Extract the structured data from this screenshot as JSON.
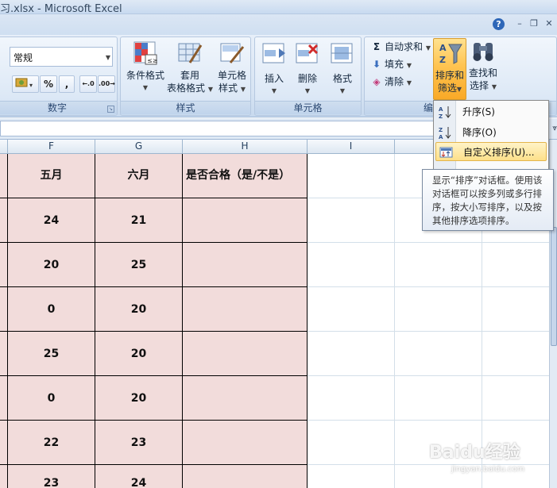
{
  "window": {
    "title": "习.xlsx - Microsoft Excel"
  },
  "ribbon": {
    "number_group": {
      "format_value": "常规",
      "percent_label": "%",
      "comma_label": ",",
      "title": "数字"
    },
    "styles_group": {
      "conditional_format": "条件格式",
      "format_as_table_l1": "套用",
      "format_as_table_l2": "表格格式",
      "cell_styles_l1": "单元格",
      "cell_styles_l2": "样式",
      "title": "样式"
    },
    "cells_group": {
      "insert": "插入",
      "delete": "删除",
      "format": "格式",
      "title": "单元格"
    },
    "editing_group": {
      "autosum": "自动求和",
      "fill": "填充",
      "clear": "清除",
      "sort_filter_l1": "排序和",
      "sort_filter_l2": "筛选",
      "find_select_l1": "查找和",
      "find_select_l2": "选择",
      "title": "编"
    }
  },
  "sort_menu": {
    "items": [
      {
        "label": "升序(S)"
      },
      {
        "label": "降序(O)"
      },
      {
        "label": "自定义排序(U)..."
      }
    ]
  },
  "tooltip": {
    "text": "显示“排序”对话框。使用该对话框可以按多列或多行排序，按大小写排序，以及按其他排序选项排序。"
  },
  "sheet": {
    "column_headers": [
      "F",
      "G",
      "H",
      "I"
    ],
    "header_row": [
      "五月",
      "六月",
      "是否合格（是/不是）"
    ],
    "rows": [
      [
        "24",
        "21",
        ""
      ],
      [
        "20",
        "25",
        ""
      ],
      [
        "0",
        "20",
        ""
      ],
      [
        "25",
        "20",
        ""
      ],
      [
        "0",
        "20",
        ""
      ],
      [
        "22",
        "23",
        ""
      ],
      [
        "23",
        "24",
        ""
      ]
    ]
  },
  "watermark": {
    "text": "Baidu经验",
    "sub": "jingyan.baidu.com"
  },
  "colors": {
    "cell_fill": "#f2dcdb",
    "active_button": "#ffc451",
    "ribbon_bg": "#dbe6f4"
  }
}
